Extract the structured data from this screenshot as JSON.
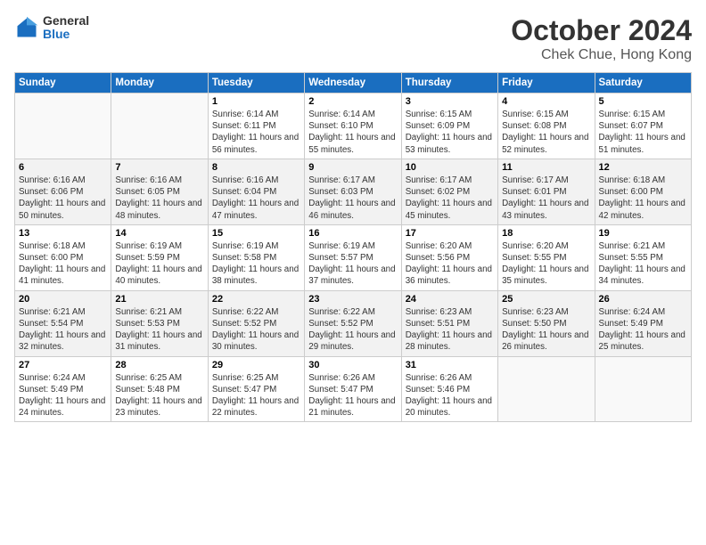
{
  "header": {
    "logo_general": "General",
    "logo_blue": "Blue",
    "month_title": "October 2024",
    "subtitle": "Chek Chue, Hong Kong"
  },
  "weekdays": [
    "Sunday",
    "Monday",
    "Tuesday",
    "Wednesday",
    "Thursday",
    "Friday",
    "Saturday"
  ],
  "weeks": [
    [
      {
        "day": "",
        "sunrise": "",
        "sunset": "",
        "daylight": "",
        "empty": true
      },
      {
        "day": "",
        "sunrise": "",
        "sunset": "",
        "daylight": "",
        "empty": true
      },
      {
        "day": "1",
        "sunrise": "Sunrise: 6:14 AM",
        "sunset": "Sunset: 6:11 PM",
        "daylight": "Daylight: 11 hours and 56 minutes.",
        "empty": false
      },
      {
        "day": "2",
        "sunrise": "Sunrise: 6:14 AM",
        "sunset": "Sunset: 6:10 PM",
        "daylight": "Daylight: 11 hours and 55 minutes.",
        "empty": false
      },
      {
        "day": "3",
        "sunrise": "Sunrise: 6:15 AM",
        "sunset": "Sunset: 6:09 PM",
        "daylight": "Daylight: 11 hours and 53 minutes.",
        "empty": false
      },
      {
        "day": "4",
        "sunrise": "Sunrise: 6:15 AM",
        "sunset": "Sunset: 6:08 PM",
        "daylight": "Daylight: 11 hours and 52 minutes.",
        "empty": false
      },
      {
        "day": "5",
        "sunrise": "Sunrise: 6:15 AM",
        "sunset": "Sunset: 6:07 PM",
        "daylight": "Daylight: 11 hours and 51 minutes.",
        "empty": false
      }
    ],
    [
      {
        "day": "6",
        "sunrise": "Sunrise: 6:16 AM",
        "sunset": "Sunset: 6:06 PM",
        "daylight": "Daylight: 11 hours and 50 minutes.",
        "empty": false
      },
      {
        "day": "7",
        "sunrise": "Sunrise: 6:16 AM",
        "sunset": "Sunset: 6:05 PM",
        "daylight": "Daylight: 11 hours and 48 minutes.",
        "empty": false
      },
      {
        "day": "8",
        "sunrise": "Sunrise: 6:16 AM",
        "sunset": "Sunset: 6:04 PM",
        "daylight": "Daylight: 11 hours and 47 minutes.",
        "empty": false
      },
      {
        "day": "9",
        "sunrise": "Sunrise: 6:17 AM",
        "sunset": "Sunset: 6:03 PM",
        "daylight": "Daylight: 11 hours and 46 minutes.",
        "empty": false
      },
      {
        "day": "10",
        "sunrise": "Sunrise: 6:17 AM",
        "sunset": "Sunset: 6:02 PM",
        "daylight": "Daylight: 11 hours and 45 minutes.",
        "empty": false
      },
      {
        "day": "11",
        "sunrise": "Sunrise: 6:17 AM",
        "sunset": "Sunset: 6:01 PM",
        "daylight": "Daylight: 11 hours and 43 minutes.",
        "empty": false
      },
      {
        "day": "12",
        "sunrise": "Sunrise: 6:18 AM",
        "sunset": "Sunset: 6:00 PM",
        "daylight": "Daylight: 11 hours and 42 minutes.",
        "empty": false
      }
    ],
    [
      {
        "day": "13",
        "sunrise": "Sunrise: 6:18 AM",
        "sunset": "Sunset: 6:00 PM",
        "daylight": "Daylight: 11 hours and 41 minutes.",
        "empty": false
      },
      {
        "day": "14",
        "sunrise": "Sunrise: 6:19 AM",
        "sunset": "Sunset: 5:59 PM",
        "daylight": "Daylight: 11 hours and 40 minutes.",
        "empty": false
      },
      {
        "day": "15",
        "sunrise": "Sunrise: 6:19 AM",
        "sunset": "Sunset: 5:58 PM",
        "daylight": "Daylight: 11 hours and 38 minutes.",
        "empty": false
      },
      {
        "day": "16",
        "sunrise": "Sunrise: 6:19 AM",
        "sunset": "Sunset: 5:57 PM",
        "daylight": "Daylight: 11 hours and 37 minutes.",
        "empty": false
      },
      {
        "day": "17",
        "sunrise": "Sunrise: 6:20 AM",
        "sunset": "Sunset: 5:56 PM",
        "daylight": "Daylight: 11 hours and 36 minutes.",
        "empty": false
      },
      {
        "day": "18",
        "sunrise": "Sunrise: 6:20 AM",
        "sunset": "Sunset: 5:55 PM",
        "daylight": "Daylight: 11 hours and 35 minutes.",
        "empty": false
      },
      {
        "day": "19",
        "sunrise": "Sunrise: 6:21 AM",
        "sunset": "Sunset: 5:55 PM",
        "daylight": "Daylight: 11 hours and 34 minutes.",
        "empty": false
      }
    ],
    [
      {
        "day": "20",
        "sunrise": "Sunrise: 6:21 AM",
        "sunset": "Sunset: 5:54 PM",
        "daylight": "Daylight: 11 hours and 32 minutes.",
        "empty": false
      },
      {
        "day": "21",
        "sunrise": "Sunrise: 6:21 AM",
        "sunset": "Sunset: 5:53 PM",
        "daylight": "Daylight: 11 hours and 31 minutes.",
        "empty": false
      },
      {
        "day": "22",
        "sunrise": "Sunrise: 6:22 AM",
        "sunset": "Sunset: 5:52 PM",
        "daylight": "Daylight: 11 hours and 30 minutes.",
        "empty": false
      },
      {
        "day": "23",
        "sunrise": "Sunrise: 6:22 AM",
        "sunset": "Sunset: 5:52 PM",
        "daylight": "Daylight: 11 hours and 29 minutes.",
        "empty": false
      },
      {
        "day": "24",
        "sunrise": "Sunrise: 6:23 AM",
        "sunset": "Sunset: 5:51 PM",
        "daylight": "Daylight: 11 hours and 28 minutes.",
        "empty": false
      },
      {
        "day": "25",
        "sunrise": "Sunrise: 6:23 AM",
        "sunset": "Sunset: 5:50 PM",
        "daylight": "Daylight: 11 hours and 26 minutes.",
        "empty": false
      },
      {
        "day": "26",
        "sunrise": "Sunrise: 6:24 AM",
        "sunset": "Sunset: 5:49 PM",
        "daylight": "Daylight: 11 hours and 25 minutes.",
        "empty": false
      }
    ],
    [
      {
        "day": "27",
        "sunrise": "Sunrise: 6:24 AM",
        "sunset": "Sunset: 5:49 PM",
        "daylight": "Daylight: 11 hours and 24 minutes.",
        "empty": false
      },
      {
        "day": "28",
        "sunrise": "Sunrise: 6:25 AM",
        "sunset": "Sunset: 5:48 PM",
        "daylight": "Daylight: 11 hours and 23 minutes.",
        "empty": false
      },
      {
        "day": "29",
        "sunrise": "Sunrise: 6:25 AM",
        "sunset": "Sunset: 5:47 PM",
        "daylight": "Daylight: 11 hours and 22 minutes.",
        "empty": false
      },
      {
        "day": "30",
        "sunrise": "Sunrise: 6:26 AM",
        "sunset": "Sunset: 5:47 PM",
        "daylight": "Daylight: 11 hours and 21 minutes.",
        "empty": false
      },
      {
        "day": "31",
        "sunrise": "Sunrise: 6:26 AM",
        "sunset": "Sunset: 5:46 PM",
        "daylight": "Daylight: 11 hours and 20 minutes.",
        "empty": false
      },
      {
        "day": "",
        "sunrise": "",
        "sunset": "",
        "daylight": "",
        "empty": true
      },
      {
        "day": "",
        "sunrise": "",
        "sunset": "",
        "daylight": "",
        "empty": true
      }
    ]
  ]
}
